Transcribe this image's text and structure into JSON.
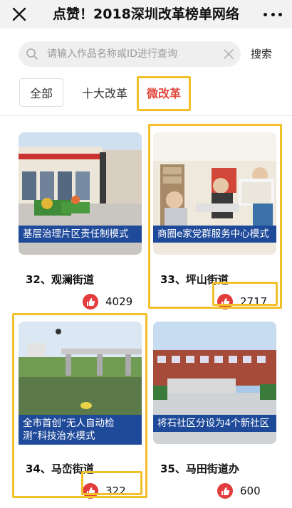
{
  "header": {
    "title": "点赞！2018深圳改革榜单网络",
    "close_icon": "close-icon",
    "more_icon": "more-icon"
  },
  "search": {
    "placeholder": "请输入作品名称或ID进行查询",
    "value": "",
    "button_label": "搜索"
  },
  "tabs": [
    {
      "label": "全部",
      "selected": false
    },
    {
      "label": "十大改革",
      "selected": false
    },
    {
      "label": "微改革",
      "selected": true
    }
  ],
  "cards": [
    {
      "caption": "基层治理片区责任制模式",
      "name": "32、观澜街道",
      "likes": "4029",
      "highlighted": false
    },
    {
      "caption": "商圈e家党群服务中心模式",
      "name": "33、坪山街道",
      "likes": "2717",
      "highlighted": true
    },
    {
      "caption": "全市首创“无人自动检测”科技治水模式",
      "name": "34、马峦街道",
      "likes": "322",
      "highlighted": true
    },
    {
      "caption": "将石社区分设为4个新社区",
      "name": "35、马田街道办",
      "likes": "600",
      "highlighted": false
    }
  ],
  "colors": {
    "accent": "#e2463b",
    "banner": "#1f4a9a",
    "highlight": "#f2c02a",
    "like": "#e33c3c"
  }
}
